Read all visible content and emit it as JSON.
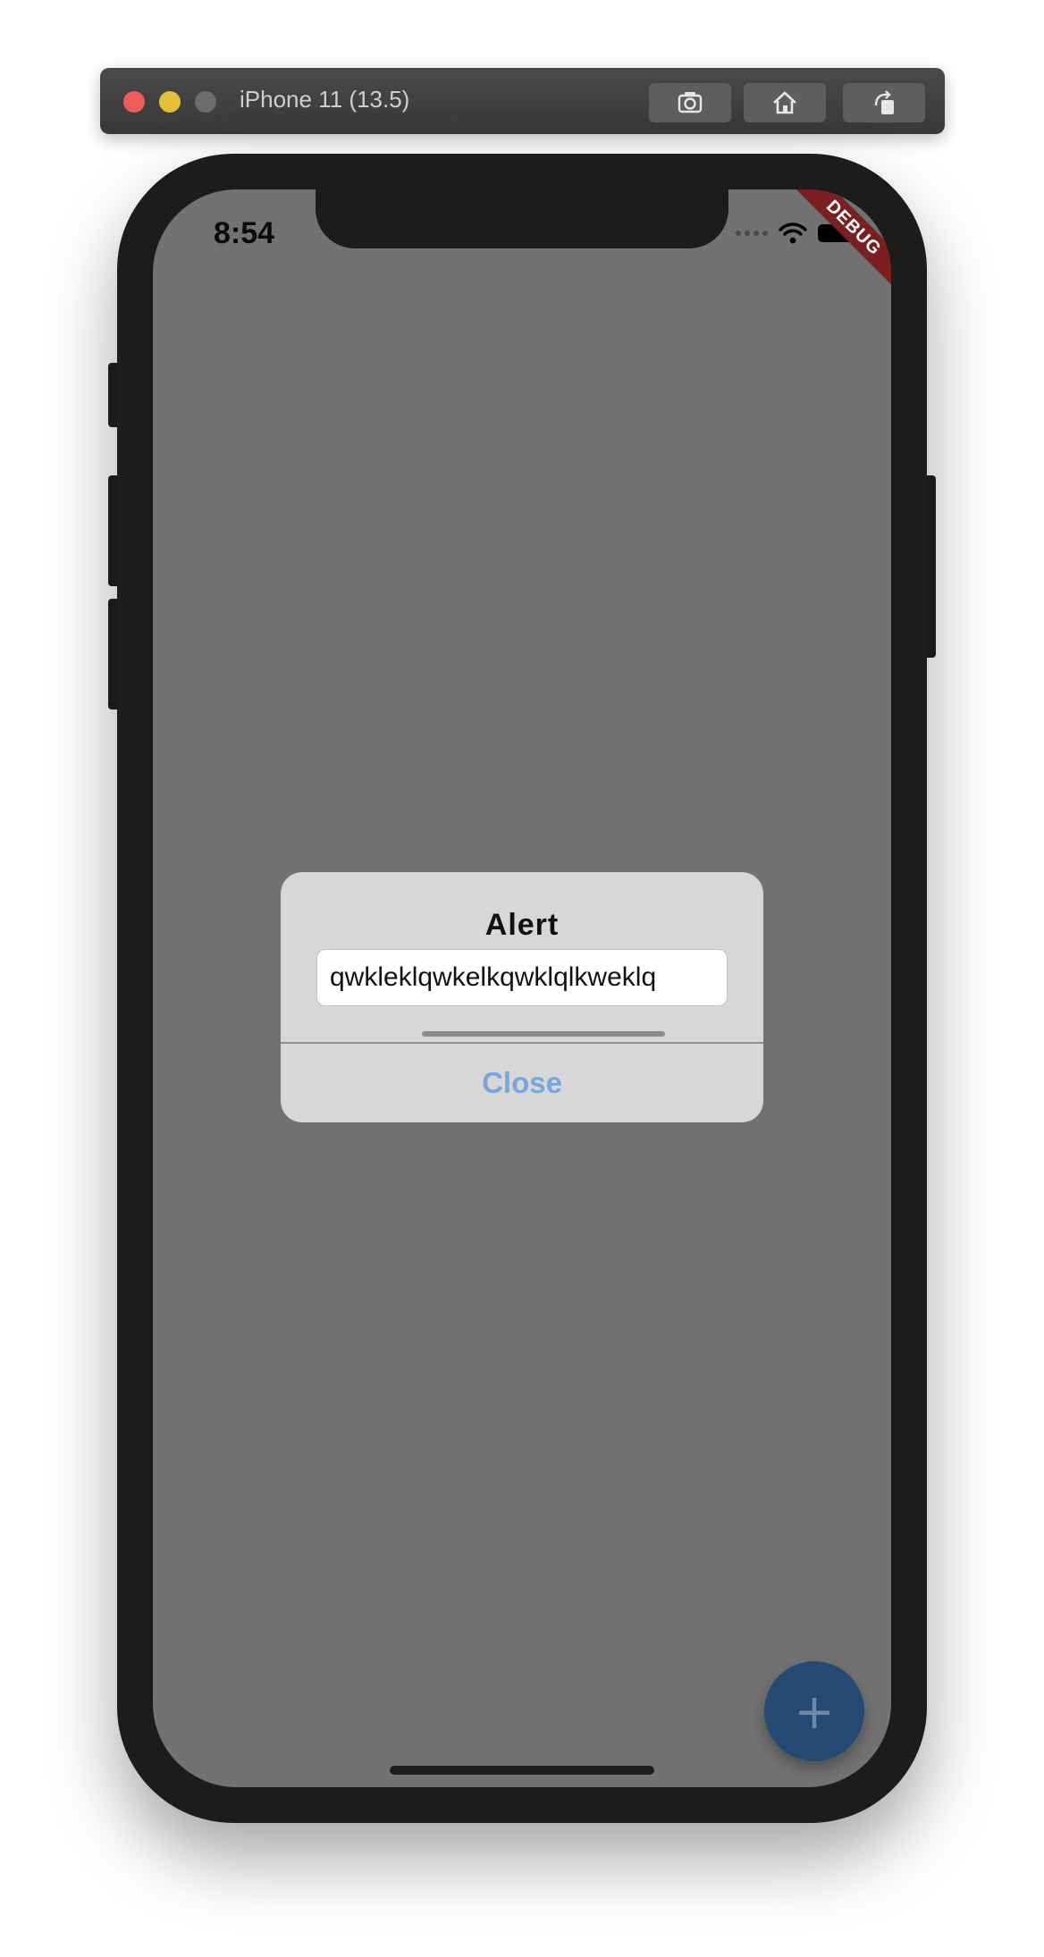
{
  "simulator": {
    "title": "iPhone 11 (13.5)",
    "buttons": [
      {
        "name": "screenshot",
        "icon": "camera-icon"
      },
      {
        "name": "home",
        "icon": "home-icon"
      },
      {
        "name": "rotate",
        "icon": "rotate-icon"
      }
    ]
  },
  "status_bar": {
    "time": "8:54",
    "debug_banner": "DEBUG"
  },
  "alert": {
    "title": "Alert",
    "input_value": "qwkleklqwkelkqwklqlkweklq",
    "action_label": "Close"
  },
  "fab": {
    "label": "+"
  },
  "colors": {
    "screen_overlay": "#727272",
    "fab": "#244a74",
    "action_text": "#79a6de",
    "debug_ribbon": "#7a1f22"
  }
}
